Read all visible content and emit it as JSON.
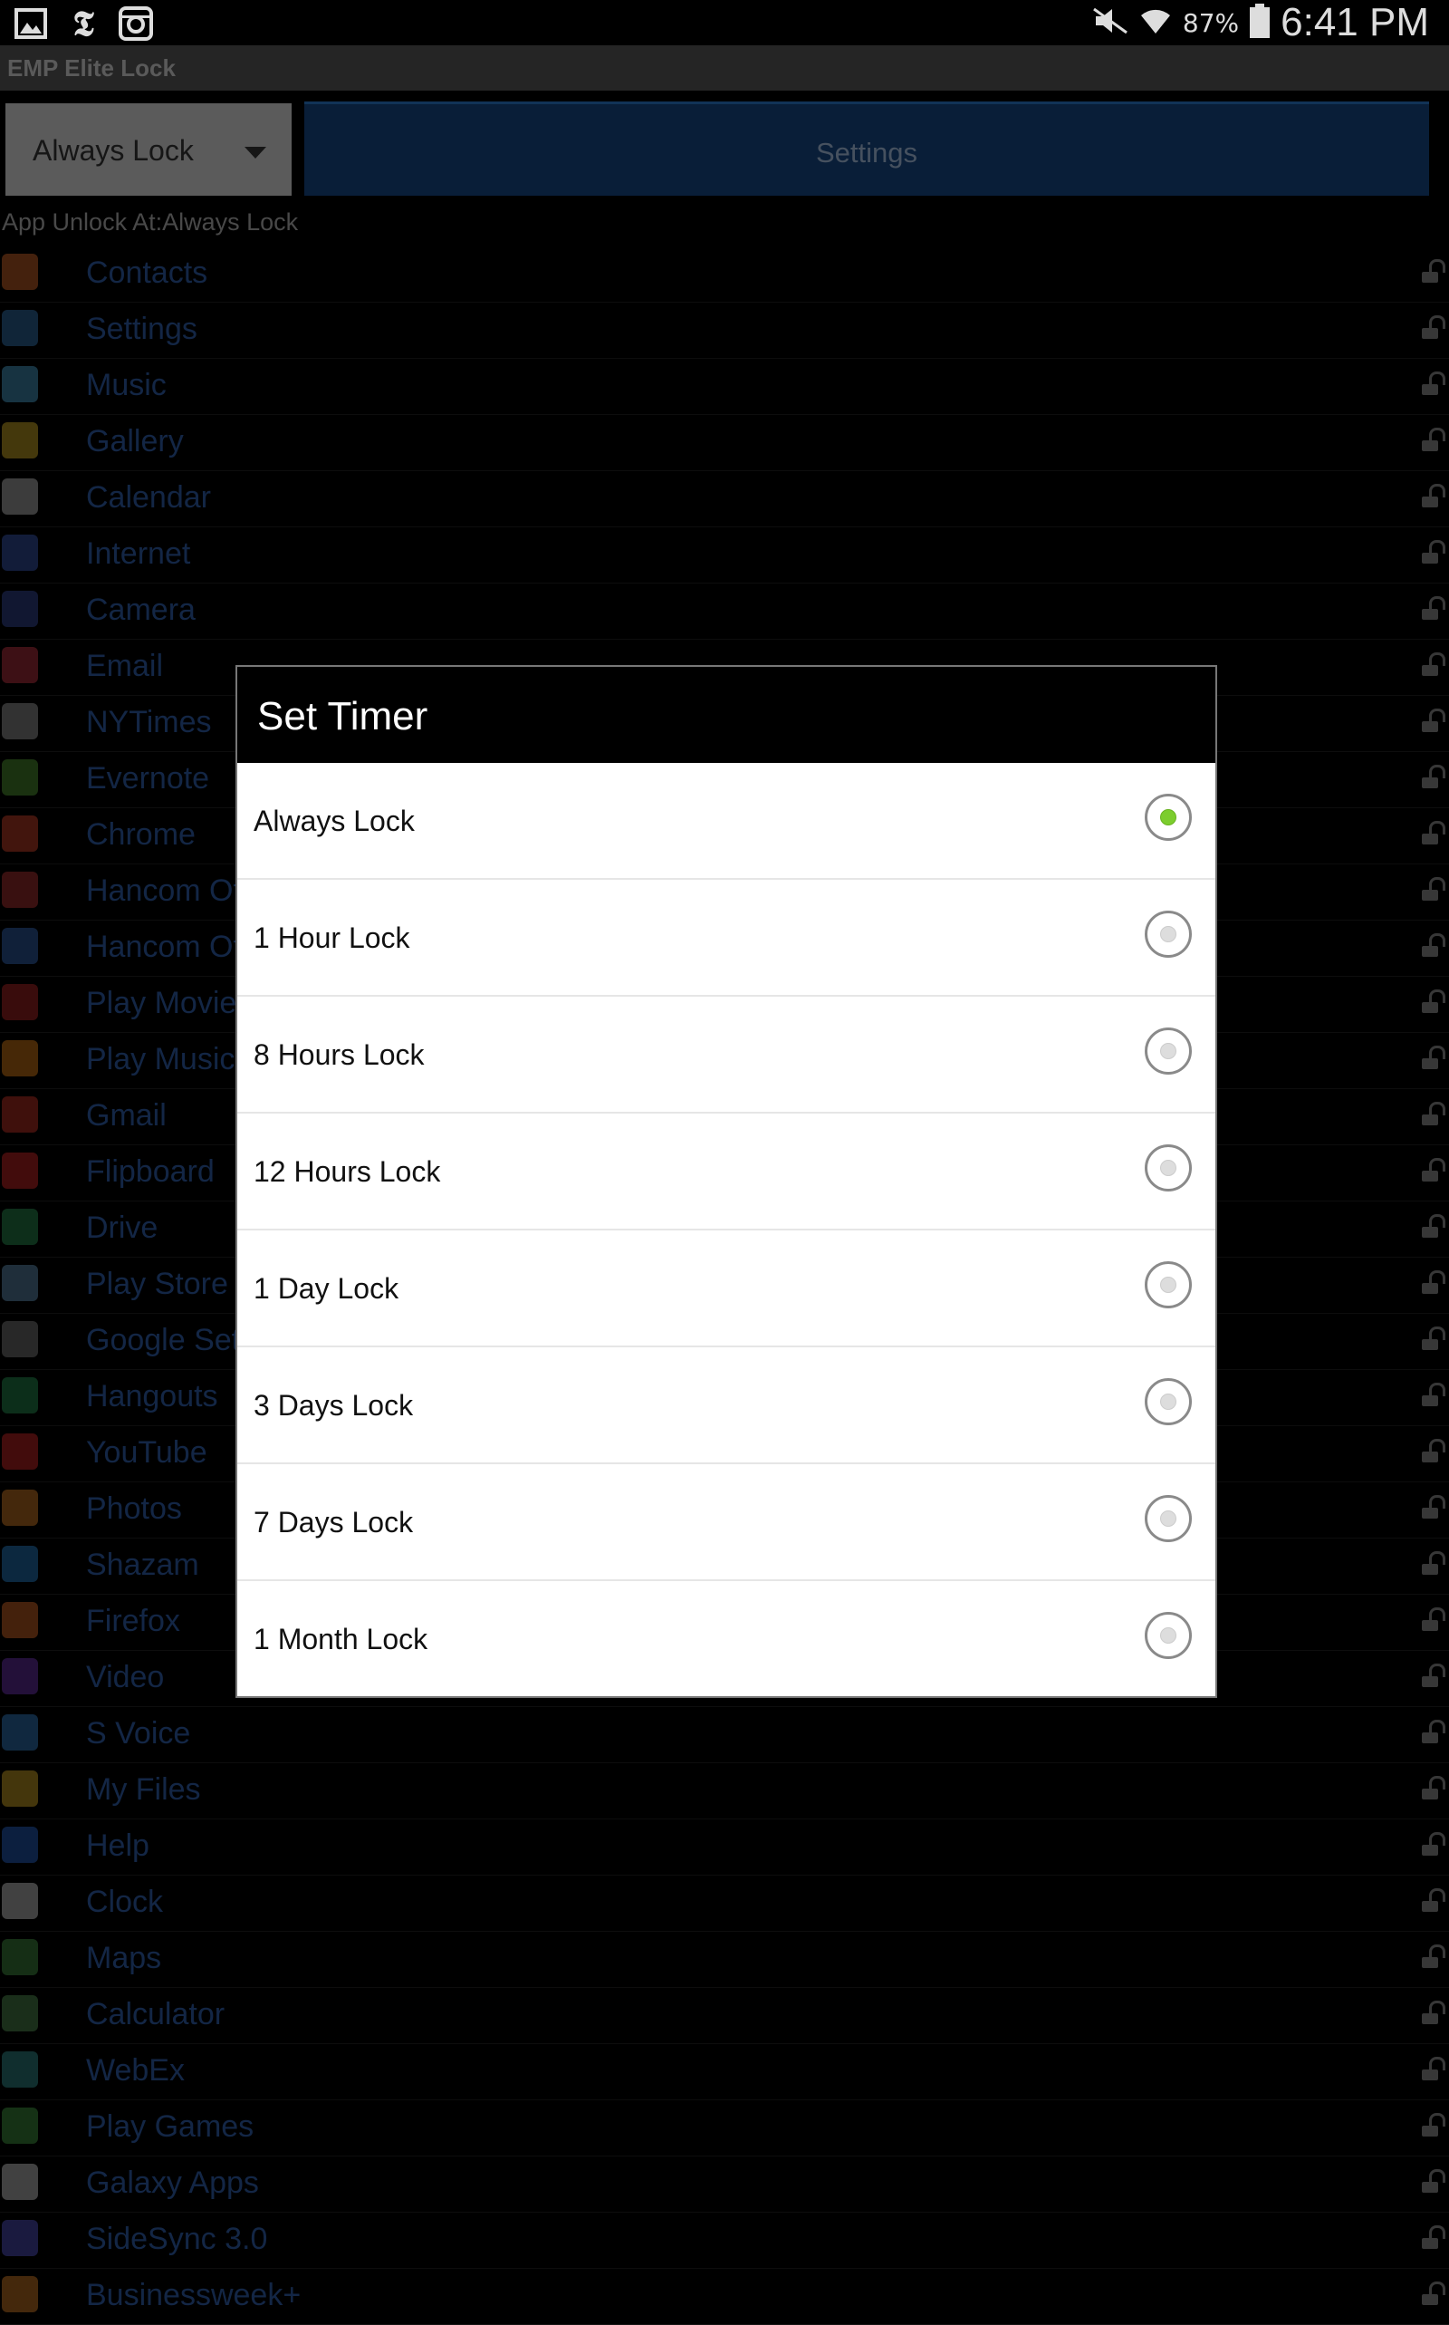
{
  "status_bar": {
    "left_icons": [
      "gallery-icon",
      "nytimes-icon",
      "instagram-icon"
    ],
    "battery_percent": "87%",
    "time": "6:41 PM"
  },
  "app": {
    "title": "EMP Elite Lock",
    "spinner_value": "Always Lock",
    "settings_label": "Settings",
    "unlock_at_label": "App Unlock At:Always Lock"
  },
  "apps": [
    {
      "name": "Contacts",
      "color": "#e8742c"
    },
    {
      "name": "Settings",
      "color": "#3a7fc1"
    },
    {
      "name": "Music",
      "color": "#4fb0e0"
    },
    {
      "name": "Gallery",
      "color": "#e9c22a"
    },
    {
      "name": "Calendar",
      "color": "#cfcfcf"
    },
    {
      "name": "Internet",
      "color": "#3d5fc4"
    },
    {
      "name": "Camera",
      "color": "#3b4fa8"
    },
    {
      "name": "Email",
      "color": "#d23a4a"
    },
    {
      "name": "NYTimes",
      "color": "#aaaaaa"
    },
    {
      "name": "Evernote",
      "color": "#5aa83a"
    },
    {
      "name": "Chrome",
      "color": "#e2492f"
    },
    {
      "name": "Hancom Office",
      "color": "#c43a3a"
    },
    {
      "name": "Hancom Office",
      "color": "#3a6fc4"
    },
    {
      "name": "Play Movies",
      "color": "#c42a2a"
    },
    {
      "name": "Play Music",
      "color": "#f08a1a"
    },
    {
      "name": "Gmail",
      "color": "#d93a2a"
    },
    {
      "name": "Flipboard",
      "color": "#e22a2a"
    },
    {
      "name": "Drive",
      "color": "#2ea05a"
    },
    {
      "name": "Play Store",
      "color": "#6aa0c8"
    },
    {
      "name": "Google Settings",
      "color": "#8a8a8a"
    },
    {
      "name": "Hangouts",
      "color": "#2aa05a"
    },
    {
      "name": "YouTube",
      "color": "#e22a2a"
    },
    {
      "name": "Photos",
      "color": "#e88a2a"
    },
    {
      "name": "Shazam",
      "color": "#2a8ad8"
    },
    {
      "name": "Firefox",
      "color": "#e8742a"
    },
    {
      "name": "Video",
      "color": "#7a3ac4"
    },
    {
      "name": "S Voice",
      "color": "#3a8ad8"
    },
    {
      "name": "My Files",
      "color": "#e8b82a"
    },
    {
      "name": "Help",
      "color": "#2a6ad8"
    },
    {
      "name": "Clock",
      "color": "#dddddd"
    },
    {
      "name": "Maps",
      "color": "#4aa04a"
    },
    {
      "name": "Calculator",
      "color": "#5aa05a"
    },
    {
      "name": "WebEx",
      "color": "#3aa0a0"
    },
    {
      "name": "Play Games",
      "color": "#4aa84a"
    },
    {
      "name": "Galaxy Apps",
      "color": "#dddddd"
    },
    {
      "name": "SideSync 3.0",
      "color": "#5a5ad8"
    },
    {
      "name": "Businessweek+",
      "color": "#e88a2a"
    }
  ],
  "dialog": {
    "title": "Set Timer",
    "options": [
      {
        "label": "Always Lock",
        "checked": true
      },
      {
        "label": "1 Hour Lock",
        "checked": false
      },
      {
        "label": "8 Hours Lock",
        "checked": false
      },
      {
        "label": "12 Hours Lock",
        "checked": false
      },
      {
        "label": "1 Day Lock",
        "checked": false
      },
      {
        "label": "3 Days Lock",
        "checked": false
      },
      {
        "label": "7 Days Lock",
        "checked": false
      },
      {
        "label": "1 Month Lock",
        "checked": false
      }
    ]
  }
}
